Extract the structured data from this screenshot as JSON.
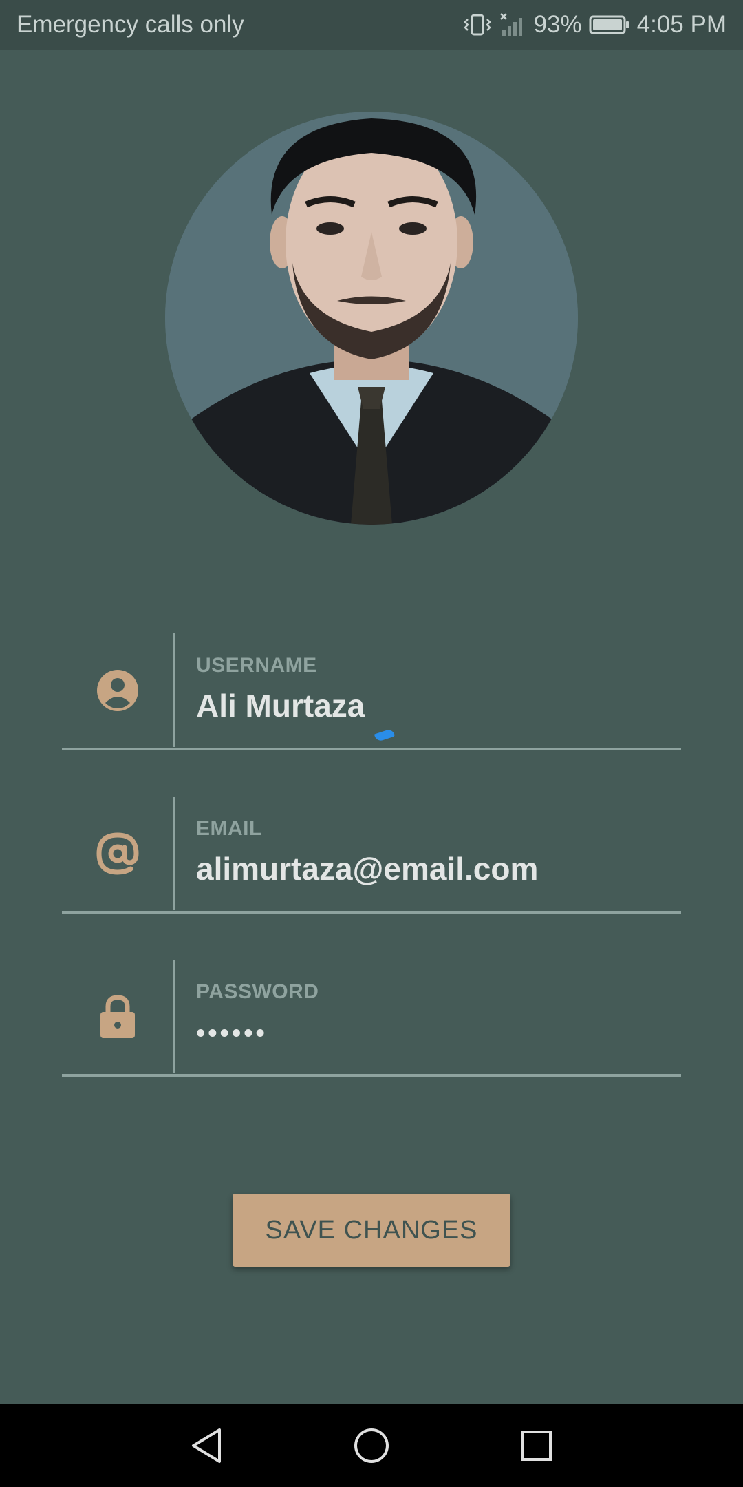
{
  "status_bar": {
    "carrier": "Emergency calls only",
    "battery_percent": "93%",
    "time": "4:05 PM",
    "icons": [
      "vibrate-icon",
      "no-signal-icon",
      "battery-icon"
    ]
  },
  "profile": {
    "avatar_alt": "profile-photo"
  },
  "form": {
    "username": {
      "label": "USERNAME",
      "value": "Ali Murtaza",
      "icon": "person-icon"
    },
    "email": {
      "label": "EMAIL",
      "value": "alimurtaza@email.com",
      "icon": "at-sign-icon"
    },
    "password": {
      "label": "PASSWORD",
      "value": "••••••",
      "icon": "lock-icon"
    }
  },
  "actions": {
    "save_label": "SAVE CHANGES"
  },
  "nav": {
    "buttons": [
      "back-icon",
      "home-icon",
      "recents-icon"
    ]
  },
  "colors": {
    "background": "#455b57",
    "accent": "#c7a583",
    "label": "#8fa39f",
    "value": "#e3e6e5"
  }
}
